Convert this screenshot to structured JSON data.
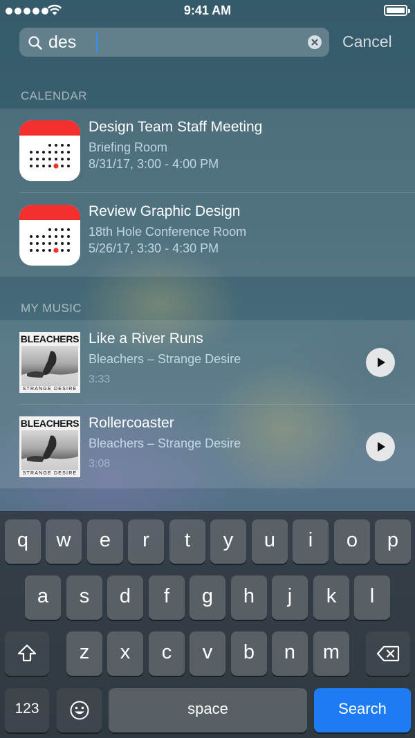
{
  "status_bar": {
    "time": "9:41 AM"
  },
  "search": {
    "query": "des",
    "cancel_label": "Cancel"
  },
  "calendar": {
    "header": "CALENDAR",
    "items": [
      {
        "title": "Design Team Staff Meeting",
        "location": "Briefing Room",
        "datetime": "8/31/17, 3:00 - 4:00 PM"
      },
      {
        "title": "Review Graphic Design",
        "location": "18th Hole Conference Room",
        "datetime": "5/26/17, 3:30 - 4:30 PM"
      }
    ]
  },
  "music": {
    "header": "MY MUSIC",
    "items": [
      {
        "title": "Like a River Runs",
        "subtitle": "Bleachers – Strange Desire",
        "duration": "3:33",
        "album_band": "BLEACHERS",
        "album_title": "STRANGE DESIRE"
      },
      {
        "title": "Rollercoaster",
        "subtitle": "Bleachers – Strange Desire",
        "duration": "3:08",
        "album_band": "BLEACHERS",
        "album_title": "STRANGE DESIRE"
      }
    ]
  },
  "keyboard": {
    "row1": [
      "q",
      "w",
      "e",
      "r",
      "t",
      "y",
      "u",
      "i",
      "o",
      "p"
    ],
    "row2": [
      "a",
      "s",
      "d",
      "f",
      "g",
      "h",
      "j",
      "k",
      "l"
    ],
    "row3": [
      "z",
      "x",
      "c",
      "v",
      "b",
      "n",
      "m"
    ],
    "numbers_label": "123",
    "space_label": "space",
    "search_label": "Search",
    "icons": {
      "shift": "shift-icon",
      "delete": "delete-icon",
      "emoji": "emoji-icon"
    }
  },
  "colors": {
    "accent": "#1d7cf2",
    "calendar_red": "#f4302d",
    "caret": "#3b8ef5"
  }
}
